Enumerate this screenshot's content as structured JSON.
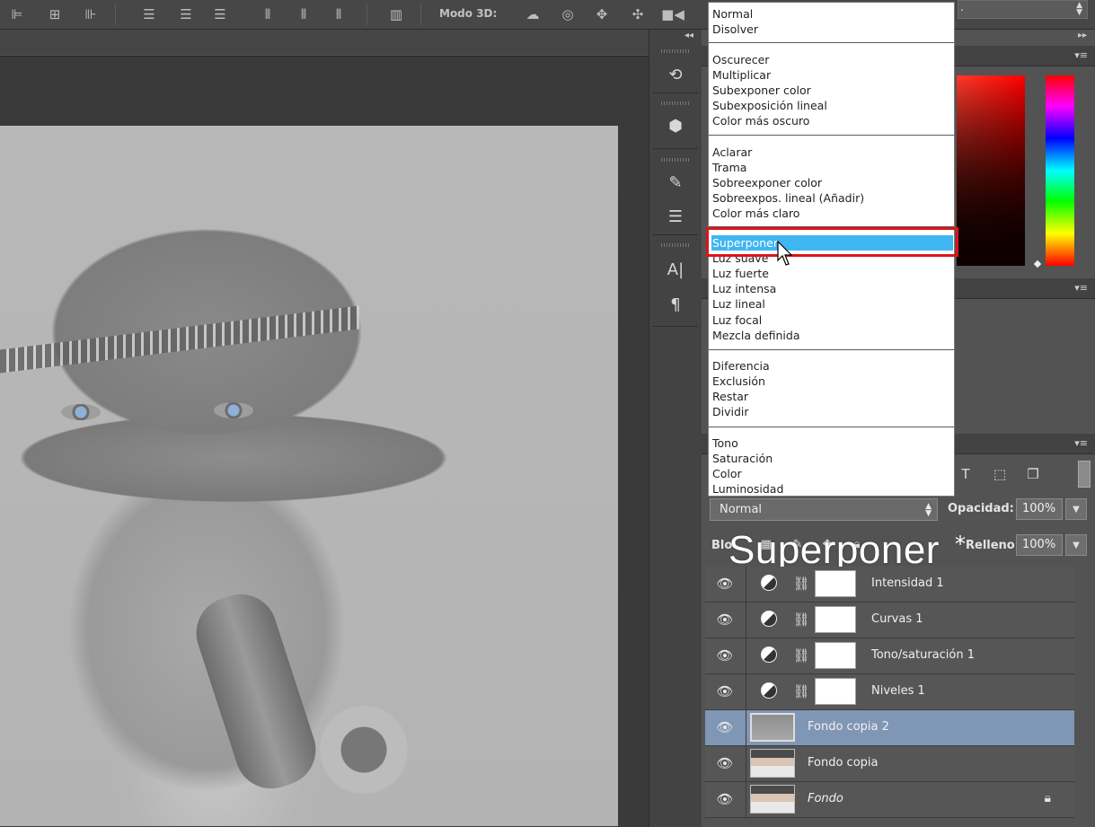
{
  "toolbar": {
    "mode3d_label": "Modo 3D:",
    "top_select_value": ".",
    "icons": [
      "align-left-icon",
      "align-center-icon",
      "align-right-icon",
      "distribute-top-icon",
      "distribute-middle-icon",
      "distribute-bottom-icon",
      "distribute-left-icon",
      "distribute-center-icon",
      "distribute-right-icon",
      "auto-align-icon",
      "rotate-3d-icon",
      "roll-3d-icon",
      "pan-3d-icon",
      "slide-3d-icon",
      "scale-3d-icon"
    ]
  },
  "blend_menu": {
    "groups": [
      [
        "Normal",
        "Disolver"
      ],
      [
        "Oscurecer",
        "Multiplicar",
        "Subexponer color",
        "Subexposición lineal",
        "Color más oscuro"
      ],
      [
        "Aclarar",
        "Trama",
        "Sobreexponer color",
        "Sobreexpos. lineal (Añadir)",
        "Color más claro"
      ],
      [
        "Superponer",
        "Luz suave",
        "Luz fuerte",
        "Luz intensa",
        "Luz lineal",
        "Luz focal",
        "Mezcla definida"
      ],
      [
        "Diferencia",
        "Exclusión",
        "Restar",
        "Dividir"
      ],
      [
        "Tono",
        "Saturación",
        "Color",
        "Luminosidad"
      ]
    ],
    "highlighted": "Superponer"
  },
  "layers_panel": {
    "blend_mode_value": "Normal",
    "opacity_label": "Opacidad:",
    "opacity_value": "100%",
    "lock_label": "Blo",
    "fill_label": "Relleno:",
    "fill_value": "100%"
  },
  "overlay_caption": "Superponer",
  "overlay_star": "*",
  "layers": [
    {
      "name": "Intensidad 1",
      "kind": "adjustment",
      "selected": false
    },
    {
      "name": "Curvas 1",
      "kind": "adjustment",
      "selected": false
    },
    {
      "name": "Tono/saturación 1",
      "kind": "adjustment",
      "selected": false
    },
    {
      "name": "Niveles 1",
      "kind": "adjustment",
      "selected": false
    },
    {
      "name": "Fondo copia 2",
      "kind": "image",
      "selected": true
    },
    {
      "name": "Fondo copia",
      "kind": "image",
      "selected": false
    },
    {
      "name": "Fondo",
      "kind": "image",
      "selected": false,
      "locked": true
    }
  ],
  "colors": {
    "menu_highlight": "#3fb5f2",
    "callout_box": "#e0121b",
    "selected_layer": "#8096b5"
  }
}
